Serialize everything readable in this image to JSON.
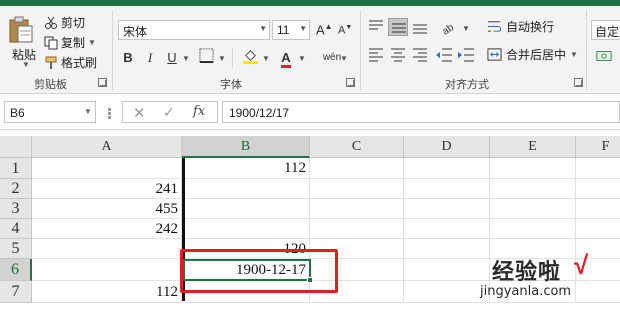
{
  "ribbon": {
    "clipboard": {
      "paste_label": "粘贴",
      "cut_label": "剪切",
      "copy_label": "复制",
      "format_painter_label": "格式刷",
      "group_label": "剪贴板"
    },
    "font": {
      "font_name": "宋体",
      "font_size": "11",
      "bold": "B",
      "italic": "I",
      "underline": "U",
      "grow": "A",
      "shrink": "A",
      "font_color_letter": "A",
      "phonetic_label": "wén",
      "group_label": "字体"
    },
    "alignment": {
      "wrap_text_label": "自动换行",
      "merge_center_label": "合并后居中",
      "group_label": "对齐方式"
    },
    "number": {
      "format_value": "自定义"
    },
    "colors": {
      "fill_color": "#ffe600",
      "font_color": "#e02020",
      "accent": "#217346"
    }
  },
  "formula_bar": {
    "name_box": "B6",
    "cancel_symbol": "✕",
    "enter_symbol": "✓",
    "fx_symbol": "fx",
    "formula": "1900/12/17"
  },
  "sheet": {
    "columns": [
      "A",
      "B",
      "C",
      "D",
      "E",
      "F"
    ],
    "rows": [
      "1",
      "2",
      "3",
      "4",
      "5",
      "6",
      "7"
    ],
    "cells": {
      "B1": "112",
      "A2": "241",
      "A3": "455",
      "A4": "242",
      "B5": "120",
      "B6": "1900-12-17",
      "A7": "112"
    },
    "active_cell": "B6"
  },
  "watermark": {
    "name": "经验啦",
    "check": "√",
    "url": "jingyanla.com"
  }
}
